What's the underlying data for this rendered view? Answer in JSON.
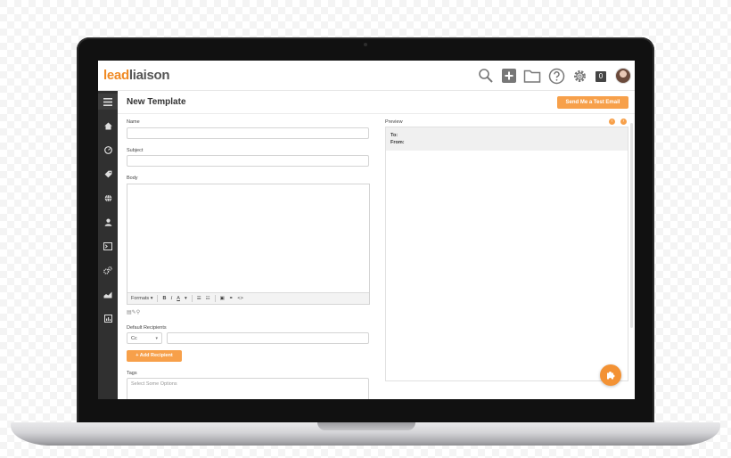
{
  "app": {
    "logo_lead": "lead",
    "logo_liaison": "liaison",
    "notification_count": "0"
  },
  "topbar_icons": [
    "search-icon",
    "add-icon",
    "folder-icon",
    "help-icon",
    "gear-icon"
  ],
  "sidebar_icons": [
    "menu-icon",
    "home-icon",
    "dashboard-icon",
    "tag-icon",
    "globe-icon",
    "user-icon",
    "terminal-icon",
    "settings-icon",
    "chart-icon",
    "report-icon"
  ],
  "page": {
    "title": "New Template",
    "send_test_label": "Send Me a Test Email"
  },
  "form": {
    "name_label": "Name",
    "name_value": "",
    "subject_label": "Subject",
    "subject_value": "",
    "body_label": "Body",
    "toolbar": {
      "formats": "Formats",
      "bold": "B",
      "italic": "I",
      "font_color": "A",
      "code": "<>"
    },
    "default_recipients_label": "Default Recipients",
    "recipient_type": "Cc",
    "recipient_value": "",
    "add_recipient_label": "+ Add Recipient",
    "tags_label": "Tags",
    "tags_placeholder": "Select Some Options"
  },
  "preview": {
    "label": "Preview",
    "to_label": "To:",
    "from_label": "From:"
  },
  "colors": {
    "accent": "#f7a04a",
    "sidebar": "#303030",
    "logo_orange": "#f08a24"
  }
}
